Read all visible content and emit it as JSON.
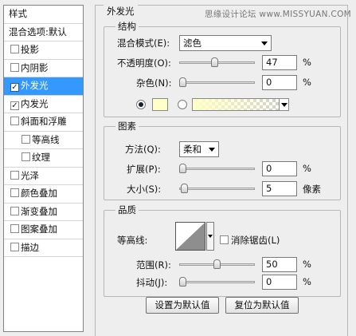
{
  "watermark": "思缘设计论坛 www.MISSYUAN.COM",
  "sidebar": {
    "header": "样式",
    "items": [
      {
        "label": "混合选项:默认",
        "checkbox": false,
        "checked": false,
        "indent": false,
        "selected": false
      },
      {
        "label": "投影",
        "checkbox": true,
        "checked": false,
        "indent": false,
        "selected": false
      },
      {
        "label": "内阴影",
        "checkbox": true,
        "checked": false,
        "indent": false,
        "selected": false
      },
      {
        "label": "外发光",
        "checkbox": true,
        "checked": true,
        "indent": false,
        "selected": true
      },
      {
        "label": "内发光",
        "checkbox": true,
        "checked": true,
        "indent": false,
        "selected": false
      },
      {
        "label": "斜面和浮雕",
        "checkbox": true,
        "checked": false,
        "indent": false,
        "selected": false
      },
      {
        "label": "等高线",
        "checkbox": true,
        "checked": false,
        "indent": true,
        "selected": false
      },
      {
        "label": "纹理",
        "checkbox": true,
        "checked": false,
        "indent": true,
        "selected": false
      },
      {
        "label": "光泽",
        "checkbox": true,
        "checked": false,
        "indent": false,
        "selected": false
      },
      {
        "label": "颜色叠加",
        "checkbox": true,
        "checked": false,
        "indent": false,
        "selected": false
      },
      {
        "label": "渐变叠加",
        "checkbox": true,
        "checked": false,
        "indent": false,
        "selected": false
      },
      {
        "label": "图案叠加",
        "checkbox": true,
        "checked": false,
        "indent": false,
        "selected": false
      },
      {
        "label": "描边",
        "checkbox": true,
        "checked": false,
        "indent": false,
        "selected": false
      }
    ]
  },
  "panel": {
    "title": "外发光",
    "structure": {
      "title": "结构",
      "blend_mode_label": "混合模式(E):",
      "blend_mode_value": "滤色",
      "opacity_label": "不透明度(O):",
      "opacity_value": "47",
      "opacity_unit": "%",
      "opacity_fraction": 0.47,
      "noise_label": "杂色(N):",
      "noise_value": "0",
      "noise_unit": "%",
      "noise_fraction": 0.0,
      "color": "#ffffc8"
    },
    "elements": {
      "title": "图素",
      "technique_label": "方法(Q):",
      "technique_value": "柔和",
      "spread_label": "扩展(P):",
      "spread_value": "0",
      "spread_unit": "%",
      "spread_fraction": 0.0,
      "size_label": "大小(S):",
      "size_value": "5",
      "size_unit": "像素",
      "size_fraction": 0.02
    },
    "quality": {
      "title": "品质",
      "contour_label": "等高线:",
      "anti_alias_label": "消除锯齿(L)",
      "anti_alias_checked": false,
      "range_label": "范围(R):",
      "range_value": "50",
      "range_unit": "%",
      "range_fraction": 0.5,
      "jitter_label": "抖动(J):",
      "jitter_value": "0",
      "jitter_unit": "%",
      "jitter_fraction": 0.0
    },
    "buttons": {
      "set_default": "设置为默认值",
      "reset_default": "复位为默认值"
    }
  }
}
